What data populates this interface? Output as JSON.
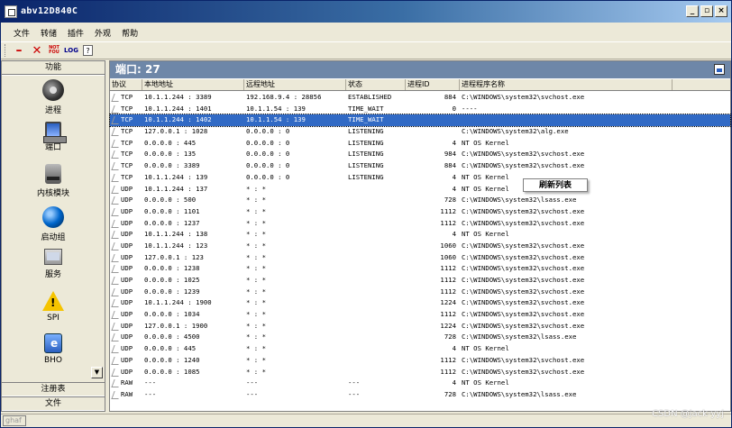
{
  "window": {
    "title": "abv12D840C"
  },
  "menu": [
    "文件",
    "转储",
    "插件",
    "外观",
    "帮助"
  ],
  "toolbar": {
    "notfound_label": "NOT FOU",
    "log_label": "LOG",
    "help_label": "?"
  },
  "left_panel": {
    "header": "功能",
    "items": [
      {
        "label": "进程",
        "icon": "process-icon"
      },
      {
        "label": "端口",
        "icon": "port-icon"
      },
      {
        "label": "内核模块",
        "icon": "kernel-module-icon"
      },
      {
        "label": "启动组",
        "icon": "startup-icon"
      },
      {
        "label": "服务",
        "icon": "services-icon"
      },
      {
        "label": "SPI",
        "icon": "warning-icon"
      },
      {
        "label": "BHO",
        "icon": "ie-icon"
      }
    ],
    "sections": [
      "注册表",
      "文件"
    ]
  },
  "main": {
    "title": "端口: 27",
    "columns": [
      "协议",
      "本地地址",
      "远程地址",
      "状态",
      "进程ID",
      "进程程序名称"
    ],
    "rows": [
      [
        "TCP",
        "10.1.1.244 : 3389",
        "192.168.9.4 : 28856",
        "ESTABLISHED",
        "884",
        "C:\\WINDOWS\\system32\\svchost.exe"
      ],
      [
        "TCP",
        "10.1.1.244 : 1401",
        "10.1.1.54 : 139",
        "TIME_WAIT",
        "0",
        "----"
      ],
      [
        "TCP",
        "10.1.1.244 : 1402",
        "10.1.1.54 : 139",
        "TIME_WAIT",
        "",
        ""
      ],
      [
        "TCP",
        "127.0.0.1 : 1028",
        "0.0.0.0 : 0",
        "LISTENING",
        "",
        "C:\\WINDOWS\\system32\\alg.exe"
      ],
      [
        "TCP",
        "0.0.0.0 : 445",
        "0.0.0.0 : 0",
        "LISTENING",
        "4",
        "NT OS Kernel"
      ],
      [
        "TCP",
        "0.0.0.0 : 135",
        "0.0.0.0 : 0",
        "LISTENING",
        "984",
        "C:\\WINDOWS\\system32\\svchost.exe"
      ],
      [
        "TCP",
        "0.0.0.0 : 3389",
        "0.0.0.0 : 0",
        "LISTENING",
        "884",
        "C:\\WINDOWS\\system32\\svchost.exe"
      ],
      [
        "TCP",
        "10.1.1.244 : 139",
        "0.0.0.0 : 0",
        "LISTENING",
        "4",
        "NT OS Kernel"
      ],
      [
        "UDP",
        "10.1.1.244 : 137",
        "* : *",
        "",
        "4",
        "NT OS Kernel"
      ],
      [
        "UDP",
        "0.0.0.0 : 500",
        "* : *",
        "",
        "728",
        "C:\\WINDOWS\\system32\\lsass.exe"
      ],
      [
        "UDP",
        "0.0.0.0 : 1101",
        "* : *",
        "",
        "1112",
        "C:\\WINDOWS\\system32\\svchost.exe"
      ],
      [
        "UDP",
        "0.0.0.0 : 1237",
        "* : *",
        "",
        "1112",
        "C:\\WINDOWS\\system32\\svchost.exe"
      ],
      [
        "UDP",
        "10.1.1.244 : 138",
        "* : *",
        "",
        "4",
        "NT OS Kernel"
      ],
      [
        "UDP",
        "10.1.1.244 : 123",
        "* : *",
        "",
        "1060",
        "C:\\WINDOWS\\system32\\svchost.exe"
      ],
      [
        "UDP",
        "127.0.0.1 : 123",
        "* : *",
        "",
        "1060",
        "C:\\WINDOWS\\system32\\svchost.exe"
      ],
      [
        "UDP",
        "0.0.0.0 : 1238",
        "* : *",
        "",
        "1112",
        "C:\\WINDOWS\\system32\\svchost.exe"
      ],
      [
        "UDP",
        "0.0.0.0 : 1025",
        "* : *",
        "",
        "1112",
        "C:\\WINDOWS\\system32\\svchost.exe"
      ],
      [
        "UDP",
        "0.0.0.0 : 1239",
        "* : *",
        "",
        "1112",
        "C:\\WINDOWS\\system32\\svchost.exe"
      ],
      [
        "UDP",
        "10.1.1.244 : 1900",
        "* : *",
        "",
        "1224",
        "C:\\WINDOWS\\system32\\svchost.exe"
      ],
      [
        "UDP",
        "0.0.0.0 : 1034",
        "* : *",
        "",
        "1112",
        "C:\\WINDOWS\\system32\\svchost.exe"
      ],
      [
        "UDP",
        "127.0.0.1 : 1900",
        "* : *",
        "",
        "1224",
        "C:\\WINDOWS\\system32\\svchost.exe"
      ],
      [
        "UDP",
        "0.0.0.0 : 4500",
        "* : *",
        "",
        "728",
        "C:\\WINDOWS\\system32\\lsass.exe"
      ],
      [
        "UDP",
        "0.0.0.0 : 445",
        "* : *",
        "",
        "4",
        "NT OS Kernel"
      ],
      [
        "UDP",
        "0.0.0.0 : 1240",
        "* : *",
        "",
        "1112",
        "C:\\WINDOWS\\system32\\svchost.exe"
      ],
      [
        "UDP",
        "0.0.0.0 : 1085",
        "* : *",
        "",
        "1112",
        "C:\\WINDOWS\\system32\\svchost.exe"
      ],
      [
        "RAW",
        "---",
        "---",
        "---",
        "4",
        "NT OS Kernel"
      ],
      [
        "RAW",
        "---",
        "---",
        "---",
        "728",
        "C:\\WINDOWS\\system32\\lsass.exe"
      ]
    ],
    "selected_row": 2
  },
  "context_menu": {
    "item": "刷新列表"
  },
  "status": {
    "text": "ghaf"
  },
  "watermark": "CSDN @jack-yyj"
}
